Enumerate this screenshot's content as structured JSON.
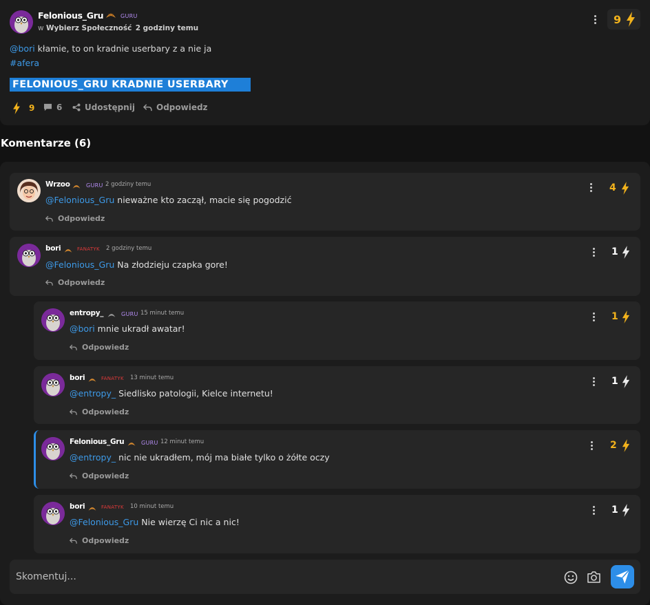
{
  "post": {
    "author": "Felonious_Gru",
    "rank": "GURU",
    "community_prefix": "w",
    "community": "Wybierz Społeczność",
    "time": "2 godziny temu",
    "mention": "@bori",
    "text": " kłamie, to on kradnie userbary z a nie ja",
    "hashtag": "#afera",
    "banner": "FELONIOUS_GRU KRADNIE USERBARY",
    "score": "9",
    "actions": {
      "likes": "9",
      "comments": "6",
      "share": "Udostępnij",
      "reply": "Odpowiedz"
    }
  },
  "comments_title": "Komentarze (6)",
  "comments": [
    {
      "author": "Wrzoo",
      "rank": "GURU",
      "time": "2 godziny temu",
      "mention": "@Felonious_Gru",
      "text": " nieważne kto zaczął, macie się pogodzić",
      "score": "4",
      "reply": "Odpowiedz"
    },
    {
      "author": "bori",
      "rank": "FANATYK",
      "time": "2 godziny temu",
      "mention": "@Felonious_Gru",
      "text": " Na złodzieju czapka gore!",
      "score": "1",
      "reply": "Odpowiedz"
    },
    {
      "author": "entropy_",
      "rank": "GURU",
      "time": "15 minut temu",
      "mention": "@bori",
      "text": " mnie ukradł awatar!",
      "score": "1",
      "reply": "Odpowiedz"
    },
    {
      "author": "bori",
      "rank": "FANATYK",
      "time": "13 minut temu",
      "mention": "@entropy_",
      "text": " Siedlisko patologii, Kielce internetu!",
      "score": "1",
      "reply": "Odpowiedz"
    },
    {
      "author": "Felonious_Gru",
      "rank": "GURU",
      "time": "12 minut temu",
      "mention": "@entropy_",
      "text": " nic nie ukradłem, mój ma białe tylko o żółte oczy",
      "score": "2",
      "reply": "Odpowiedz"
    },
    {
      "author": "bori",
      "rank": "FANATYK",
      "time": "10 minut temu",
      "mention": "@Felonious_Gru",
      "text": " Nie wierzę Ci nic a nic!",
      "score": "1",
      "reply": "Odpowiedz"
    }
  ],
  "input": {
    "placeholder": "Skomentuj..."
  },
  "colors": {
    "accent": "#3d9ae8",
    "score_gold": "#f2b21c",
    "background": "#121212",
    "card": "#262626",
    "guru": "#b48cf2",
    "fanatyk": "#e03a3a"
  }
}
